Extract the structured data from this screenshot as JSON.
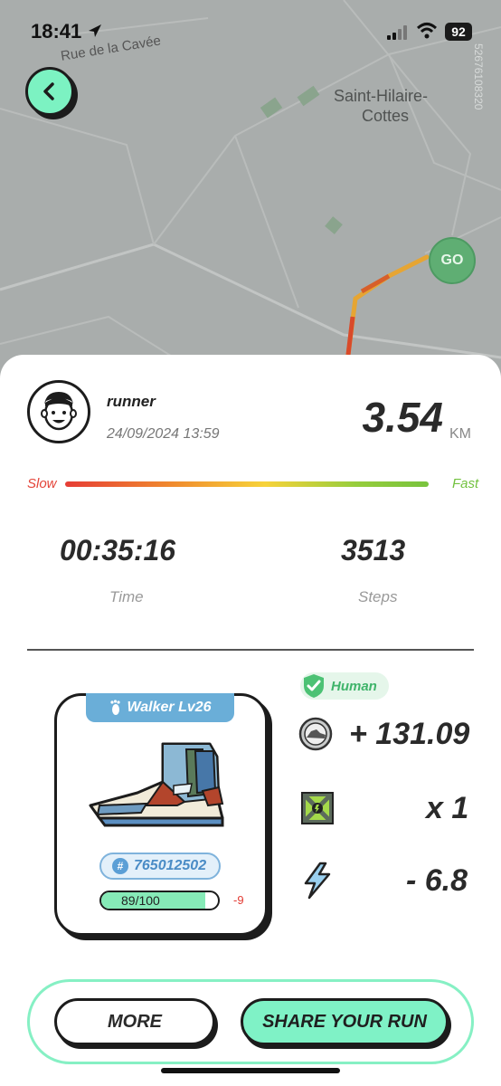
{
  "status_bar": {
    "time": "18:41",
    "battery": "92"
  },
  "map": {
    "street_label": "Rue de la Cavée",
    "place_label_line1": "Saint-Hilaire-",
    "place_label_line2": "Cottes",
    "side_code": "52676108320",
    "go_label": "GO"
  },
  "run": {
    "username": "runner",
    "datetime": "24/09/2024 13:59",
    "distance": "3.54",
    "unit": "KM",
    "pace_slow_label": "Slow",
    "pace_fast_label": "Fast",
    "time_value": "00:35:16",
    "time_label": "Time",
    "steps_value": "3513",
    "steps_label": "Steps"
  },
  "sneaker": {
    "type_level": "Walker Lv26",
    "id": "765012502",
    "durability_text": "89/100",
    "durability_fraction": 0.89,
    "durability_delta": "-9"
  },
  "rewards": {
    "badge": "Human",
    "earned": "+ 131.09",
    "box": "x 1",
    "energy": "- 6.8"
  },
  "actions": {
    "more": "MORE",
    "share": "SHARE YOUR RUN"
  },
  "colors": {
    "accent": "#7ff2c6",
    "slow": "#e4453a",
    "fast": "#72c23f",
    "human_green": "#3fb46a",
    "sneaker_blue": "#6aaed8"
  }
}
